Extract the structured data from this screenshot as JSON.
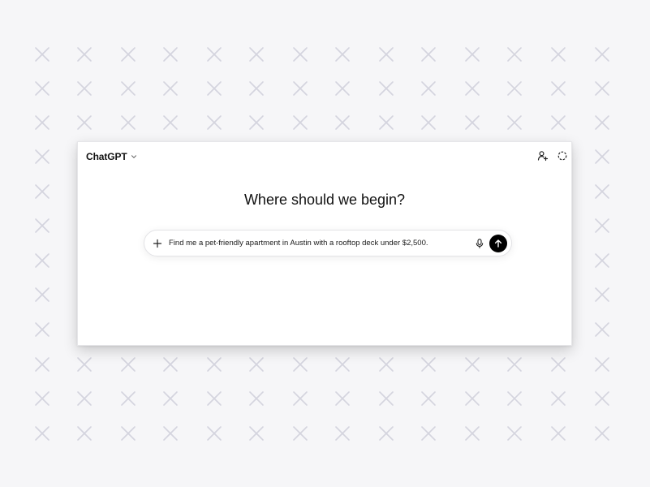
{
  "app": {
    "model_name": "ChatGPT"
  },
  "main": {
    "heading": "Where should we begin?"
  },
  "composer": {
    "input_value": "Find me a pet-friendly apartment in Austin with a rooftop deck under $2,500."
  },
  "icons": {
    "model_chevron": "chevron-down-icon",
    "share": "add-person-icon",
    "temporary_chat": "dashed-circle-icon",
    "attach": "plus-icon",
    "voice": "microphone-icon",
    "send": "arrow-up-icon"
  },
  "colors": {
    "backdrop": "#f6f6f8",
    "backdrop_cross": "#d4d4de",
    "send_button": "#000000",
    "text": "#111111"
  }
}
